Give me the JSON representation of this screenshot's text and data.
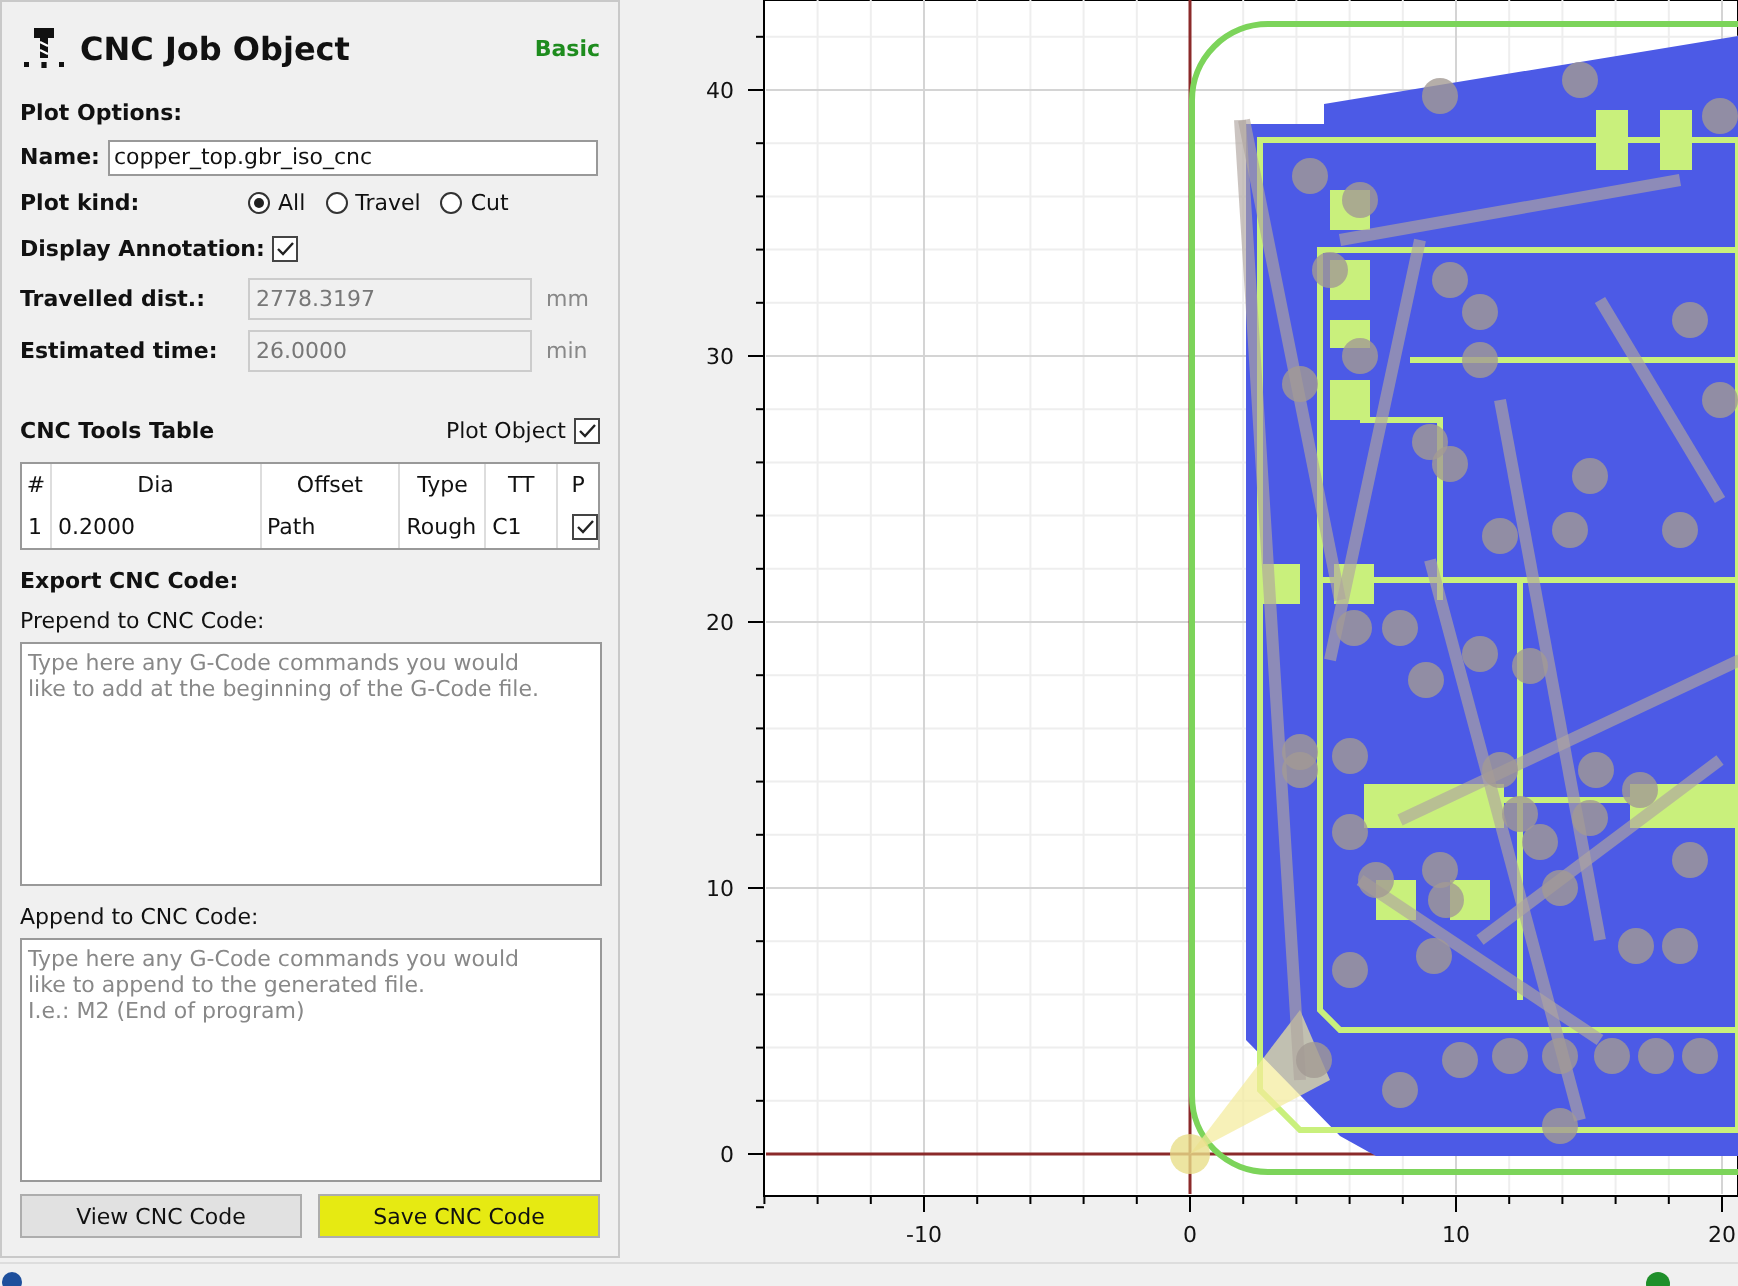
{
  "panel": {
    "title": "CNC Job Object",
    "mode_label": "Basic",
    "section": "Plot Options:",
    "name": {
      "label": "Name:",
      "value": "copper_top.gbr_iso_cnc"
    },
    "plot_kind": {
      "label": "Plot kind:",
      "options": [
        {
          "label": "All",
          "selected": true
        },
        {
          "label": "Travel",
          "selected": false
        },
        {
          "label": "Cut",
          "selected": false
        }
      ]
    },
    "display_annotation": {
      "label": "Display Annotation:",
      "checked": true
    },
    "readouts": [
      {
        "label": "Travelled dist.:",
        "value": "2778.3197",
        "unit": "mm"
      },
      {
        "label": "Estimated time:",
        "value": "26.0000",
        "unit": "min"
      }
    ],
    "tools_table": {
      "title": "CNC Tools Table",
      "plot_object": {
        "label": "Plot Object",
        "checked": true
      },
      "columns": [
        "#",
        "Dia",
        "Offset",
        "Type",
        "TT",
        "P"
      ],
      "rows": [
        {
          "cells": [
            "1",
            "0.2000",
            "Path",
            "Rough",
            "C1"
          ],
          "plot": true
        }
      ]
    },
    "export": {
      "title": "Export CNC Code:",
      "fields": [
        {
          "label": "Prepend to CNC Code:",
          "placeholder": "Type here any G-Code commands you would\nlike to add at the beginning of the G-Code file."
        },
        {
          "label": "Append to CNC Code:",
          "placeholder": "Type here any G-Code commands you would\nlike to append to the generated file.\nI.e.: M2 (End of program)"
        }
      ]
    },
    "buttons": [
      {
        "label": "View CNC Code",
        "highlighted": false
      },
      {
        "label": "Save CNC Code",
        "highlighted": true
      }
    ]
  },
  "plot": {
    "xticks": [
      "-10",
      "0",
      "10",
      "20"
    ],
    "yticks": [
      "40",
      "30",
      "20",
      "10",
      "0"
    ]
  }
}
